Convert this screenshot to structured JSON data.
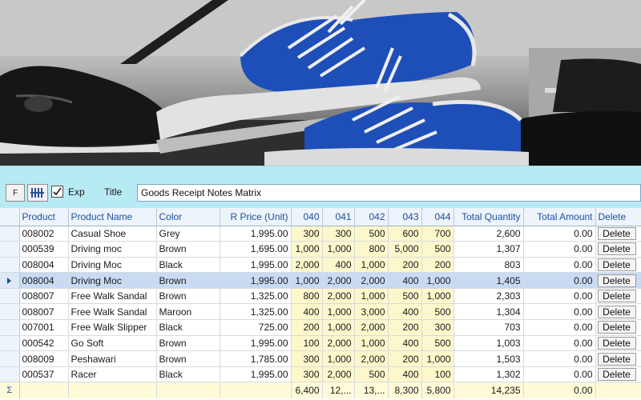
{
  "toolbar": {
    "f_button": "F",
    "exp_label": "Exp",
    "exp_checked": true,
    "title_label": "Title",
    "title_value": "Goods Receipt Notes Matrix"
  },
  "grid": {
    "headers": {
      "product": "Product",
      "product_name": "Product Name",
      "color": "Color",
      "r_price": "R Price (Unit)",
      "s040": "040",
      "s041": "041",
      "s042": "042",
      "s043": "043",
      "s044": "044",
      "total_quantity": "Total Quantity",
      "total_amount": "Total Amount",
      "delete": "Delete"
    },
    "rows": [
      {
        "product": "008002",
        "name": "Casual Shoe",
        "color": "Grey",
        "price": "1,995.00",
        "s040": "300",
        "s041": "300",
        "s042": "500",
        "s043": "600",
        "s044": "700",
        "qty": "2,600",
        "amount": "0.00",
        "del": "Delete"
      },
      {
        "product": "000539",
        "name": "Driving moc",
        "color": "Brown",
        "price": "1,695.00",
        "s040": "1,000",
        "s041": "1,000",
        "s042": "800",
        "s043": "5,000",
        "s044": "500",
        "qty": "1,307",
        "amount": "0.00",
        "del": "Delete"
      },
      {
        "product": "008004",
        "name": "Driving Moc",
        "color": "Black",
        "price": "1,995.00",
        "s040": "2,000",
        "s041": "400",
        "s042": "1,000",
        "s043": "200",
        "s044": "200",
        "qty": "803",
        "amount": "0.00",
        "del": "Delete"
      },
      {
        "product": "008004",
        "name": "Driving Moc",
        "color": "Brown",
        "price": "1,995.00",
        "s040": "1,000",
        "s041": "2,000",
        "s042": "2,000",
        "s043": "400",
        "s044": "1,000",
        "qty": "1,405",
        "amount": "0.00",
        "del": "Delete"
      },
      {
        "product": "008007",
        "name": "Free Walk Sandal",
        "color": "Brown",
        "price": "1,325.00",
        "s040": "800",
        "s041": "2,000",
        "s042": "1,000",
        "s043": "500",
        "s044": "1,000",
        "qty": "2,303",
        "amount": "0.00",
        "del": "Delete"
      },
      {
        "product": "008007",
        "name": "Free Walk Sandal",
        "color": "Maroon",
        "price": "1,325.00",
        "s040": "400",
        "s041": "1,000",
        "s042": "3,000",
        "s043": "400",
        "s044": "500",
        "qty": "1,304",
        "amount": "0.00",
        "del": "Delete"
      },
      {
        "product": "007001",
        "name": "Free Walk Slipper",
        "color": "Black",
        "price": "725.00",
        "s040": "200",
        "s041": "1,000",
        "s042": "2,000",
        "s043": "200",
        "s044": "300",
        "qty": "703",
        "amount": "0.00",
        "del": "Delete"
      },
      {
        "product": "000542",
        "name": "Go Soft",
        "color": "Brown",
        "price": "1,995.00",
        "s040": "100",
        "s041": "2,000",
        "s042": "1,000",
        "s043": "400",
        "s044": "500",
        "qty": "1,003",
        "amount": "0.00",
        "del": "Delete"
      },
      {
        "product": "008009",
        "name": "Peshawari",
        "color": "Brown",
        "price": "1,785.00",
        "s040": "300",
        "s041": "1,000",
        "s042": "2,000",
        "s043": "200",
        "s044": "1,000",
        "qty": "1,503",
        "amount": "0.00",
        "del": "Delete"
      },
      {
        "product": "000537",
        "name": "Racer",
        "color": "Black",
        "price": "1,995.00",
        "s040": "300",
        "s041": "2,000",
        "s042": "500",
        "s043": "400",
        "s044": "100",
        "qty": "1,302",
        "amount": "0.00",
        "del": "Delete"
      }
    ],
    "selected_row": 3,
    "totals": {
      "sigma": "Σ",
      "s040": "6,400",
      "s041": "12,...",
      "s042": "13,...",
      "s043": "8,300",
      "s044": "5,800",
      "qty": "14,235",
      "amount": "0.00"
    }
  },
  "colors": {
    "toolbar_bg": "#b8eaf4",
    "header_text": "#1a4f9c",
    "size_cell_bg": "#fdf8cc",
    "selected_row_bg": "#c9daf3",
    "shoe_blue": "#1e4fb8"
  }
}
